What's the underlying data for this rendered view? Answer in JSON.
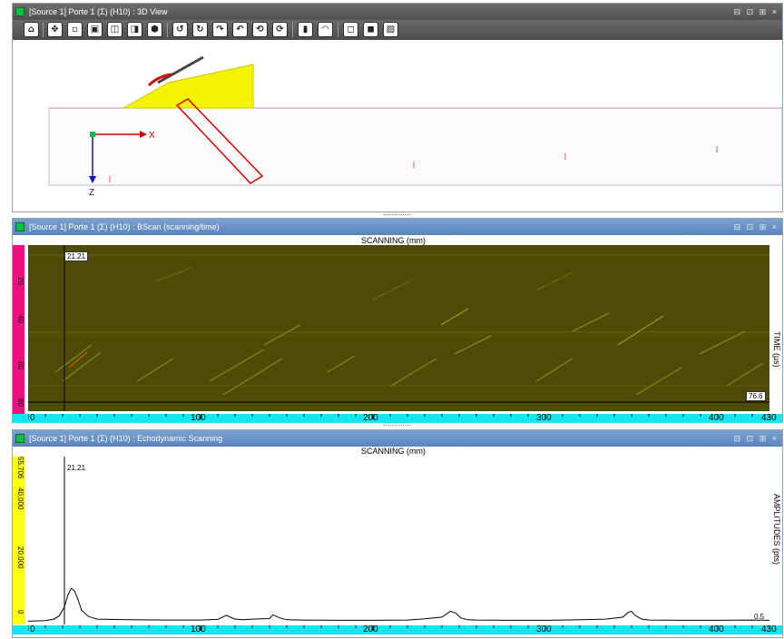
{
  "panels": {
    "view3d": {
      "title": "[Source 1] Porte 1 (Σ) (H10) : 3D View",
      "controls": "⊟ ⊡ ⊞ ×",
      "axis_x": "X",
      "axis_z": "Z",
      "toolbar_icons": [
        "home-icon",
        "fit-icon",
        "view-front-icon",
        "view-back-icon",
        "view-left-icon",
        "view-right-icon",
        "view-iso-icon",
        "rotate-left-icon",
        "rotate-right-icon",
        "rotate-up-icon",
        "rotate-down-icon",
        "rotate-ccw-icon",
        "rotate-cw-icon",
        "ruler-icon",
        "protractor-icon",
        "cube-wire-icon",
        "cube-solid-icon",
        "hatch-icon"
      ]
    },
    "bscan": {
      "title": "[Source 1] Porte 1 (Σ) (H10) : BScan (scanning/time)",
      "controls": "⊟ ⊡ ⊞ ×",
      "x_axis_label": "SCANNING (mm)",
      "y_axis_label": "TIME (µs)",
      "cursor_x_value": "21.21",
      "cursor_y_value": "76.6",
      "y_ticks": [
        "20",
        "40",
        "60",
        "80"
      ],
      "x_ticks": [
        "0",
        "100",
        "200",
        "300",
        "400",
        "430"
      ],
      "background_color": "#4e4b06",
      "scale_color": "#ee1080"
    },
    "echo": {
      "title": "[Source 1] Porte 1 (Σ) (H10) : Echodynamic Scanning",
      "controls": "⊟ ⊡ ⊞ ×",
      "x_axis_label": "SCANNING (mm)",
      "y_axis_label": "AMPLITUDES (pts)",
      "cursor_x_value": "21.21",
      "threshold_value": "0.5",
      "y_ticks": [
        "0",
        "20,000",
        "40,000",
        "55,706"
      ],
      "x_ticks": [
        "0",
        "100",
        "200",
        "300",
        "400",
        "430"
      ],
      "scale_color": "#ffff10"
    }
  },
  "chart_data": {
    "type": "line",
    "title": "SCANNING (mm)",
    "xlabel": "SCANNING (mm)",
    "ylabel": "AMPLITUDES (pts)",
    "xlim": [
      0,
      430
    ],
    "ylim": [
      0,
      55706
    ],
    "series": [
      {
        "x": [
          0,
          10,
          15,
          18,
          21,
          23,
          25,
          27,
          29,
          31,
          35,
          40,
          60,
          80,
          100,
          110,
          115,
          118,
          120,
          125,
          130,
          140,
          142,
          146,
          150,
          160,
          180,
          200,
          220,
          230,
          240,
          245,
          248,
          251,
          255,
          260,
          280,
          300,
          320,
          335,
          345,
          348,
          350,
          352,
          356,
          360,
          380,
          400,
          420,
          430
        ],
        "y": [
          200,
          400,
          900,
          2000,
          5000,
          9000,
          11500,
          10500,
          7500,
          4000,
          1800,
          900,
          700,
          600,
          600,
          800,
          2200,
          1400,
          900,
          700,
          900,
          1100,
          2400,
          1300,
          700,
          600,
          500,
          500,
          600,
          1000,
          1600,
          3600,
          3000,
          1300,
          700,
          600,
          500,
          500,
          700,
          900,
          1600,
          3200,
          3600,
          2200,
          900,
          600,
          500,
          500,
          600,
          500
        ]
      }
    ]
  }
}
